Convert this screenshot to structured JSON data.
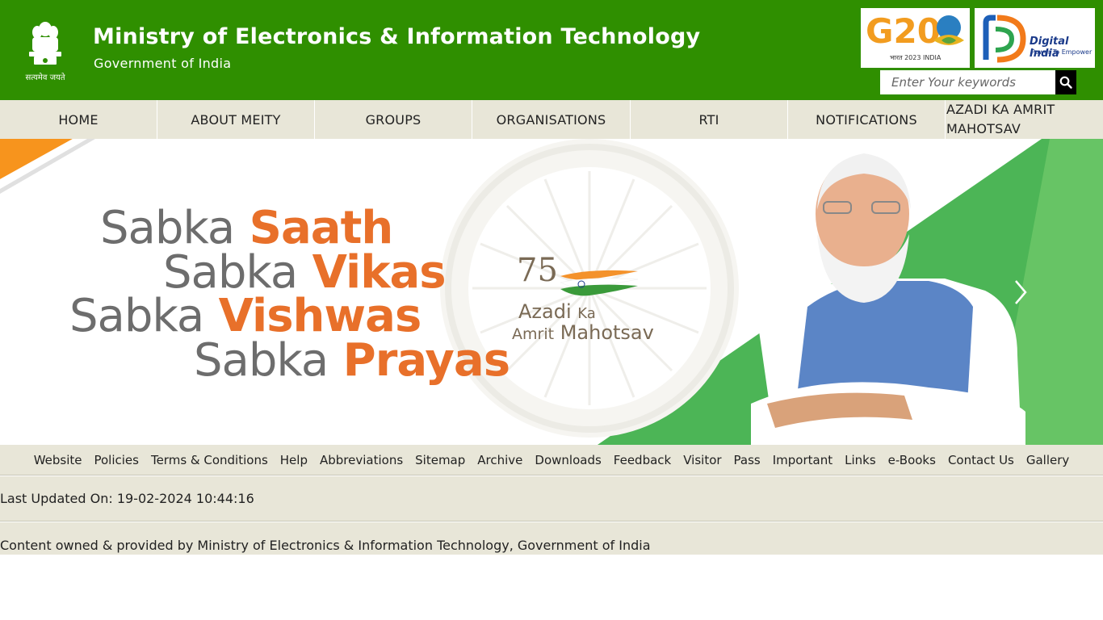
{
  "header": {
    "title": "Ministry of Electronics & Information Technology",
    "subtitle": "Government of India",
    "emblem_caption": "सत्यमेव जयते",
    "g20": {
      "logo_text": "G20",
      "sub_text": "भारत 2023 INDIA"
    },
    "digital_india": {
      "title": "Digital India",
      "tagline": "Power To Empower"
    },
    "search": {
      "placeholder": "Enter Your keywords",
      "value": ""
    }
  },
  "nav": {
    "items": [
      {
        "label": "HOME"
      },
      {
        "label": "ABOUT MEITY"
      },
      {
        "label": "GROUPS"
      },
      {
        "label": "ORGANISATIONS"
      },
      {
        "label": "RTI"
      },
      {
        "label": "NOTIFICATIONS"
      },
      {
        "label": "AZADI KA AMRIT MAHOTSAV"
      }
    ]
  },
  "banner": {
    "slogans": [
      {
        "prefix": "Sabka",
        "word": "Saath"
      },
      {
        "prefix": "Sabka",
        "word": "Vikas"
      },
      {
        "prefix": "Sabka",
        "word": "Vishwas"
      },
      {
        "prefix": "Sabka",
        "word": "Prayas"
      }
    ],
    "logo": {
      "number": "75",
      "line1": "Azadi",
      "ka": "Ka",
      "line2a": "Amrit",
      "line2b": "Mahotsav"
    },
    "colors": {
      "orange": "#e8702a",
      "green": "#3db34a",
      "grey": "#6d6d6d"
    }
  },
  "footer": {
    "links": [
      {
        "label": "Website"
      },
      {
        "label": "Policies"
      },
      {
        "label": "Terms & Conditions"
      },
      {
        "label": "Help"
      },
      {
        "label": "Abbreviations"
      },
      {
        "label": "Sitemap"
      },
      {
        "label": "Archive"
      },
      {
        "label": "Downloads"
      },
      {
        "label": "Feedback"
      },
      {
        "label": "Visitor"
      },
      {
        "label": "Pass"
      },
      {
        "label": "Important"
      },
      {
        "label": "Links"
      },
      {
        "label": "e-Books"
      },
      {
        "label": "Contact Us"
      },
      {
        "label": "Gallery"
      }
    ],
    "last_updated": "Last Updated On: 19-02-2024 10:44:16",
    "content_owner": "Content owned & provided by Ministry of Electronics & Information Technology, Government of India"
  },
  "theme": {
    "header_green": "#2f8f00",
    "nav_bg": "#e8e6d8"
  }
}
